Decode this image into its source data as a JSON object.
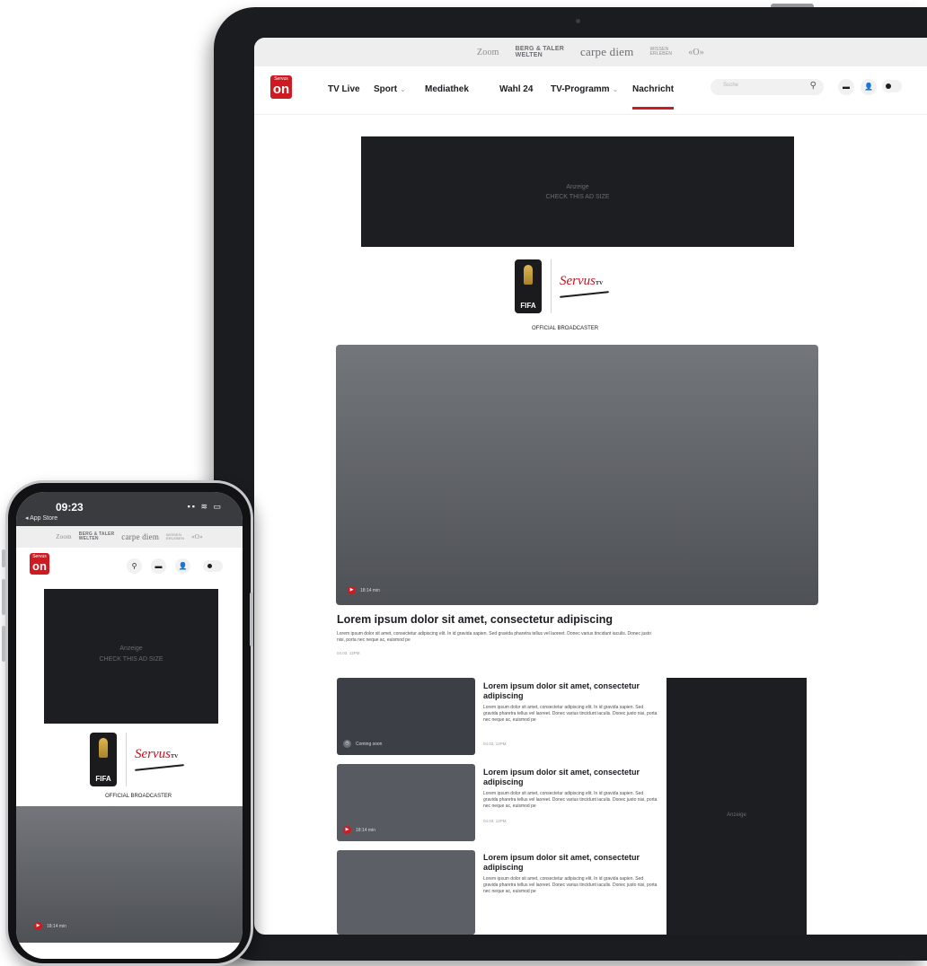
{
  "brands": {
    "b1": "Zoom",
    "b2_line1": "BERG & TALER",
    "b2_line2": "WELTEN",
    "b3": "carpe diem",
    "b4_line1": "WISSEN",
    "b4_line2": "ERLEBEN",
    "b5": "«O»"
  },
  "logo": {
    "pre": "Servus",
    "main": "on"
  },
  "nav": {
    "items": [
      "TV Live",
      "Sport",
      "Mediathek",
      "Wahl 24",
      "TV-Programm",
      "Nachricht"
    ],
    "chevron": "⌄",
    "active": "Nachricht",
    "search_placeholder": "Suche"
  },
  "icons": {
    "search": "⚲",
    "messages": "▬",
    "user": "👤",
    "play": "▶",
    "clock": "◷"
  },
  "ad": {
    "label": "Anzeige",
    "sublabel": "CHECK THIS AD SIZE"
  },
  "broadcaster": {
    "fifa": "FIFA",
    "servus": "Servus",
    "servus_tv": "TV",
    "caption": "OFFICIAL BROADCASTER"
  },
  "hero": {
    "duration": "18:14 min",
    "title": "Lorem ipsum dolor sit amet, consectetur adipiscing",
    "text": "Lorem ipsum dolor sit amet, consectetur adipiscing elit. In id gravida sapien. Sed gravida pharetra tellus vel laoreet. Donec varius tincidunt iaculis. Donec justo nisi, porta nec neque ac, euismod pe",
    "date": "04.03. 12PM"
  },
  "cards": [
    {
      "badge": "Coming soon",
      "title": "Lorem ipsum dolor sit amet, consectetur adipiscing",
      "text": "Lorem ipsum dolor sit amet, consectetur adipiscing elit. In id gravida sapien. Sed gravida pharetra tellus vel laoreet. Donec varius tincidunt iaculis. Donec justo nisi, porta nec neque ac, euismod pe",
      "date": "04.03. 12PM"
    },
    {
      "badge": "18:14 min",
      "title": "Lorem ipsum dolor sit amet, consectetur adipiscing",
      "text": "Lorem ipsum dolor sit amet, consectetur adipiscing elit. In id gravida sapien. Sed gravida pharetra tellus vel laoreet. Donec varius tincidunt iaculis. Donec justo nisi, porta nec neque ac, euismod pe",
      "date": "04.03. 12PM"
    },
    {
      "title": "Lorem ipsum dolor sit amet, consectetur adipiscing",
      "text": "Lorem ipsum dolor sit amet, consectetur adipiscing elit. In id gravida sapien. Sed gravida pharetra tellus vel laoreet. Donec varius tincidunt iaculis. Donec justo nisi, porta nec neque ac, euismod pe"
    }
  ],
  "side_ad": {
    "label": "Anzeige"
  },
  "phone": {
    "time": "09:23",
    "back_app": "◂ App Store",
    "indicators": "▪▪ ≋ ▭",
    "duration": "18:14 min"
  },
  "colors": {
    "accent": "#cf1a22",
    "dark_ad": "#1d1e22",
    "device_frame": "#1b1c1f"
  }
}
